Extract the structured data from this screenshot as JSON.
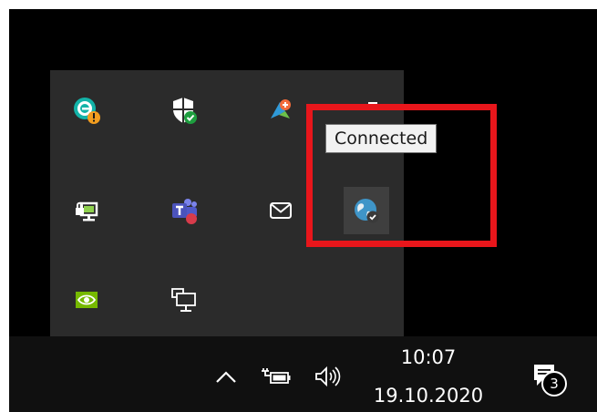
{
  "tooltip": {
    "text": "Connected"
  },
  "tray_icons": [
    {
      "name": "eset-security-icon"
    },
    {
      "name": "windows-security-icon"
    },
    {
      "name": "graphics-app-icon"
    },
    {
      "name": "partial-white-icon"
    },
    {
      "name": "network-adapter-icon"
    },
    {
      "name": "microsoft-teams-icon"
    },
    {
      "name": "mail-icon"
    },
    {
      "name": "vpn-globe-icon",
      "state": "hovered"
    },
    {
      "name": "nvidia-icon"
    },
    {
      "name": "network-display-icon"
    }
  ],
  "taskbar": {
    "time": "10:07",
    "date": "19.10.2020",
    "notification_count": "3",
    "icons": [
      "chevron-up-icon",
      "power-battery-icon",
      "volume-icon",
      "action-center-icon"
    ]
  },
  "colors": {
    "annotation": "#e8161b",
    "tray_background": "#2b2b2b",
    "taskbar_background": "#101010"
  }
}
